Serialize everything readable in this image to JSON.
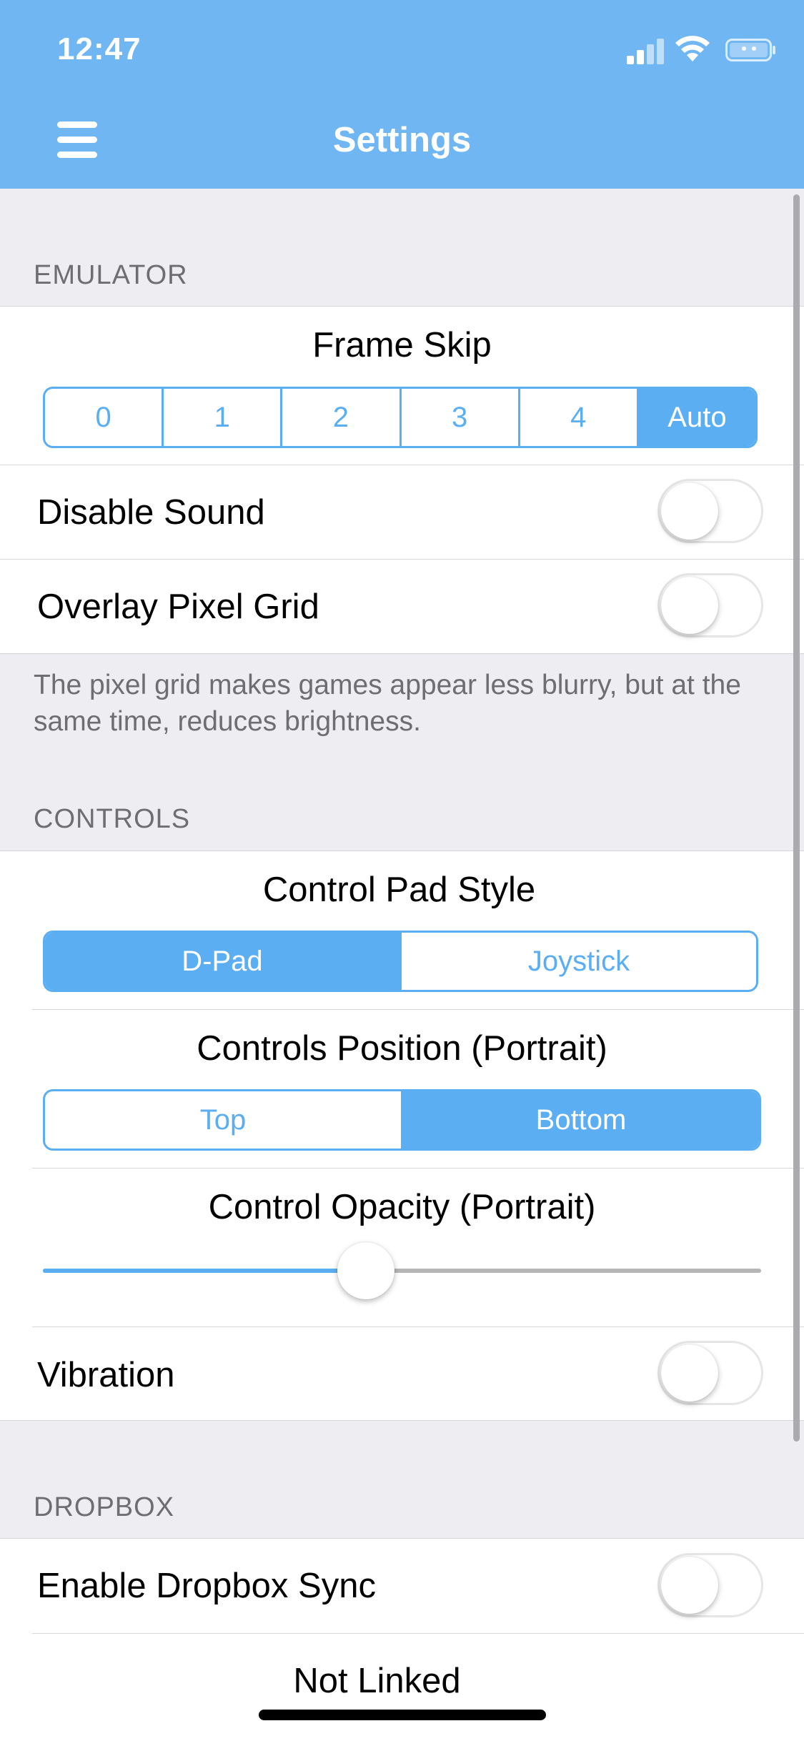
{
  "status_bar": {
    "time": "12:47"
  },
  "nav": {
    "title": "Settings",
    "menu_icon": "hamburger-menu-icon"
  },
  "sections": {
    "emulator": {
      "header": "EMULATOR",
      "frame_skip": {
        "label": "Frame Skip",
        "options": [
          "0",
          "1",
          "2",
          "3",
          "4",
          "Auto"
        ],
        "selected": "Auto"
      },
      "disable_sound": {
        "label": "Disable Sound",
        "on": false
      },
      "overlay_pixel_grid": {
        "label": "Overlay Pixel Grid",
        "on": false
      },
      "footer": "The pixel grid makes games appear less blurry, but at the same time, reduces brightness."
    },
    "controls": {
      "header": "CONTROLS",
      "control_pad_style": {
        "label": "Control Pad Style",
        "options": [
          "D-Pad",
          "Joystick"
        ],
        "selected": "D-Pad"
      },
      "controls_position": {
        "label": "Controls Position (Portrait)",
        "options": [
          "Top",
          "Bottom"
        ],
        "selected": "Bottom"
      },
      "control_opacity": {
        "label": "Control Opacity (Portrait)",
        "value": 0.45
      },
      "vibration": {
        "label": "Vibration",
        "on": false
      }
    },
    "dropbox": {
      "header": "DROPBOX",
      "enable_sync": {
        "label": "Enable Dropbox Sync",
        "on": false
      },
      "link_status": "Not Linked"
    }
  },
  "colors": {
    "nav_bar": "#70B6F3",
    "accent": "#5BAEF2",
    "background": "#EDEDF2"
  }
}
